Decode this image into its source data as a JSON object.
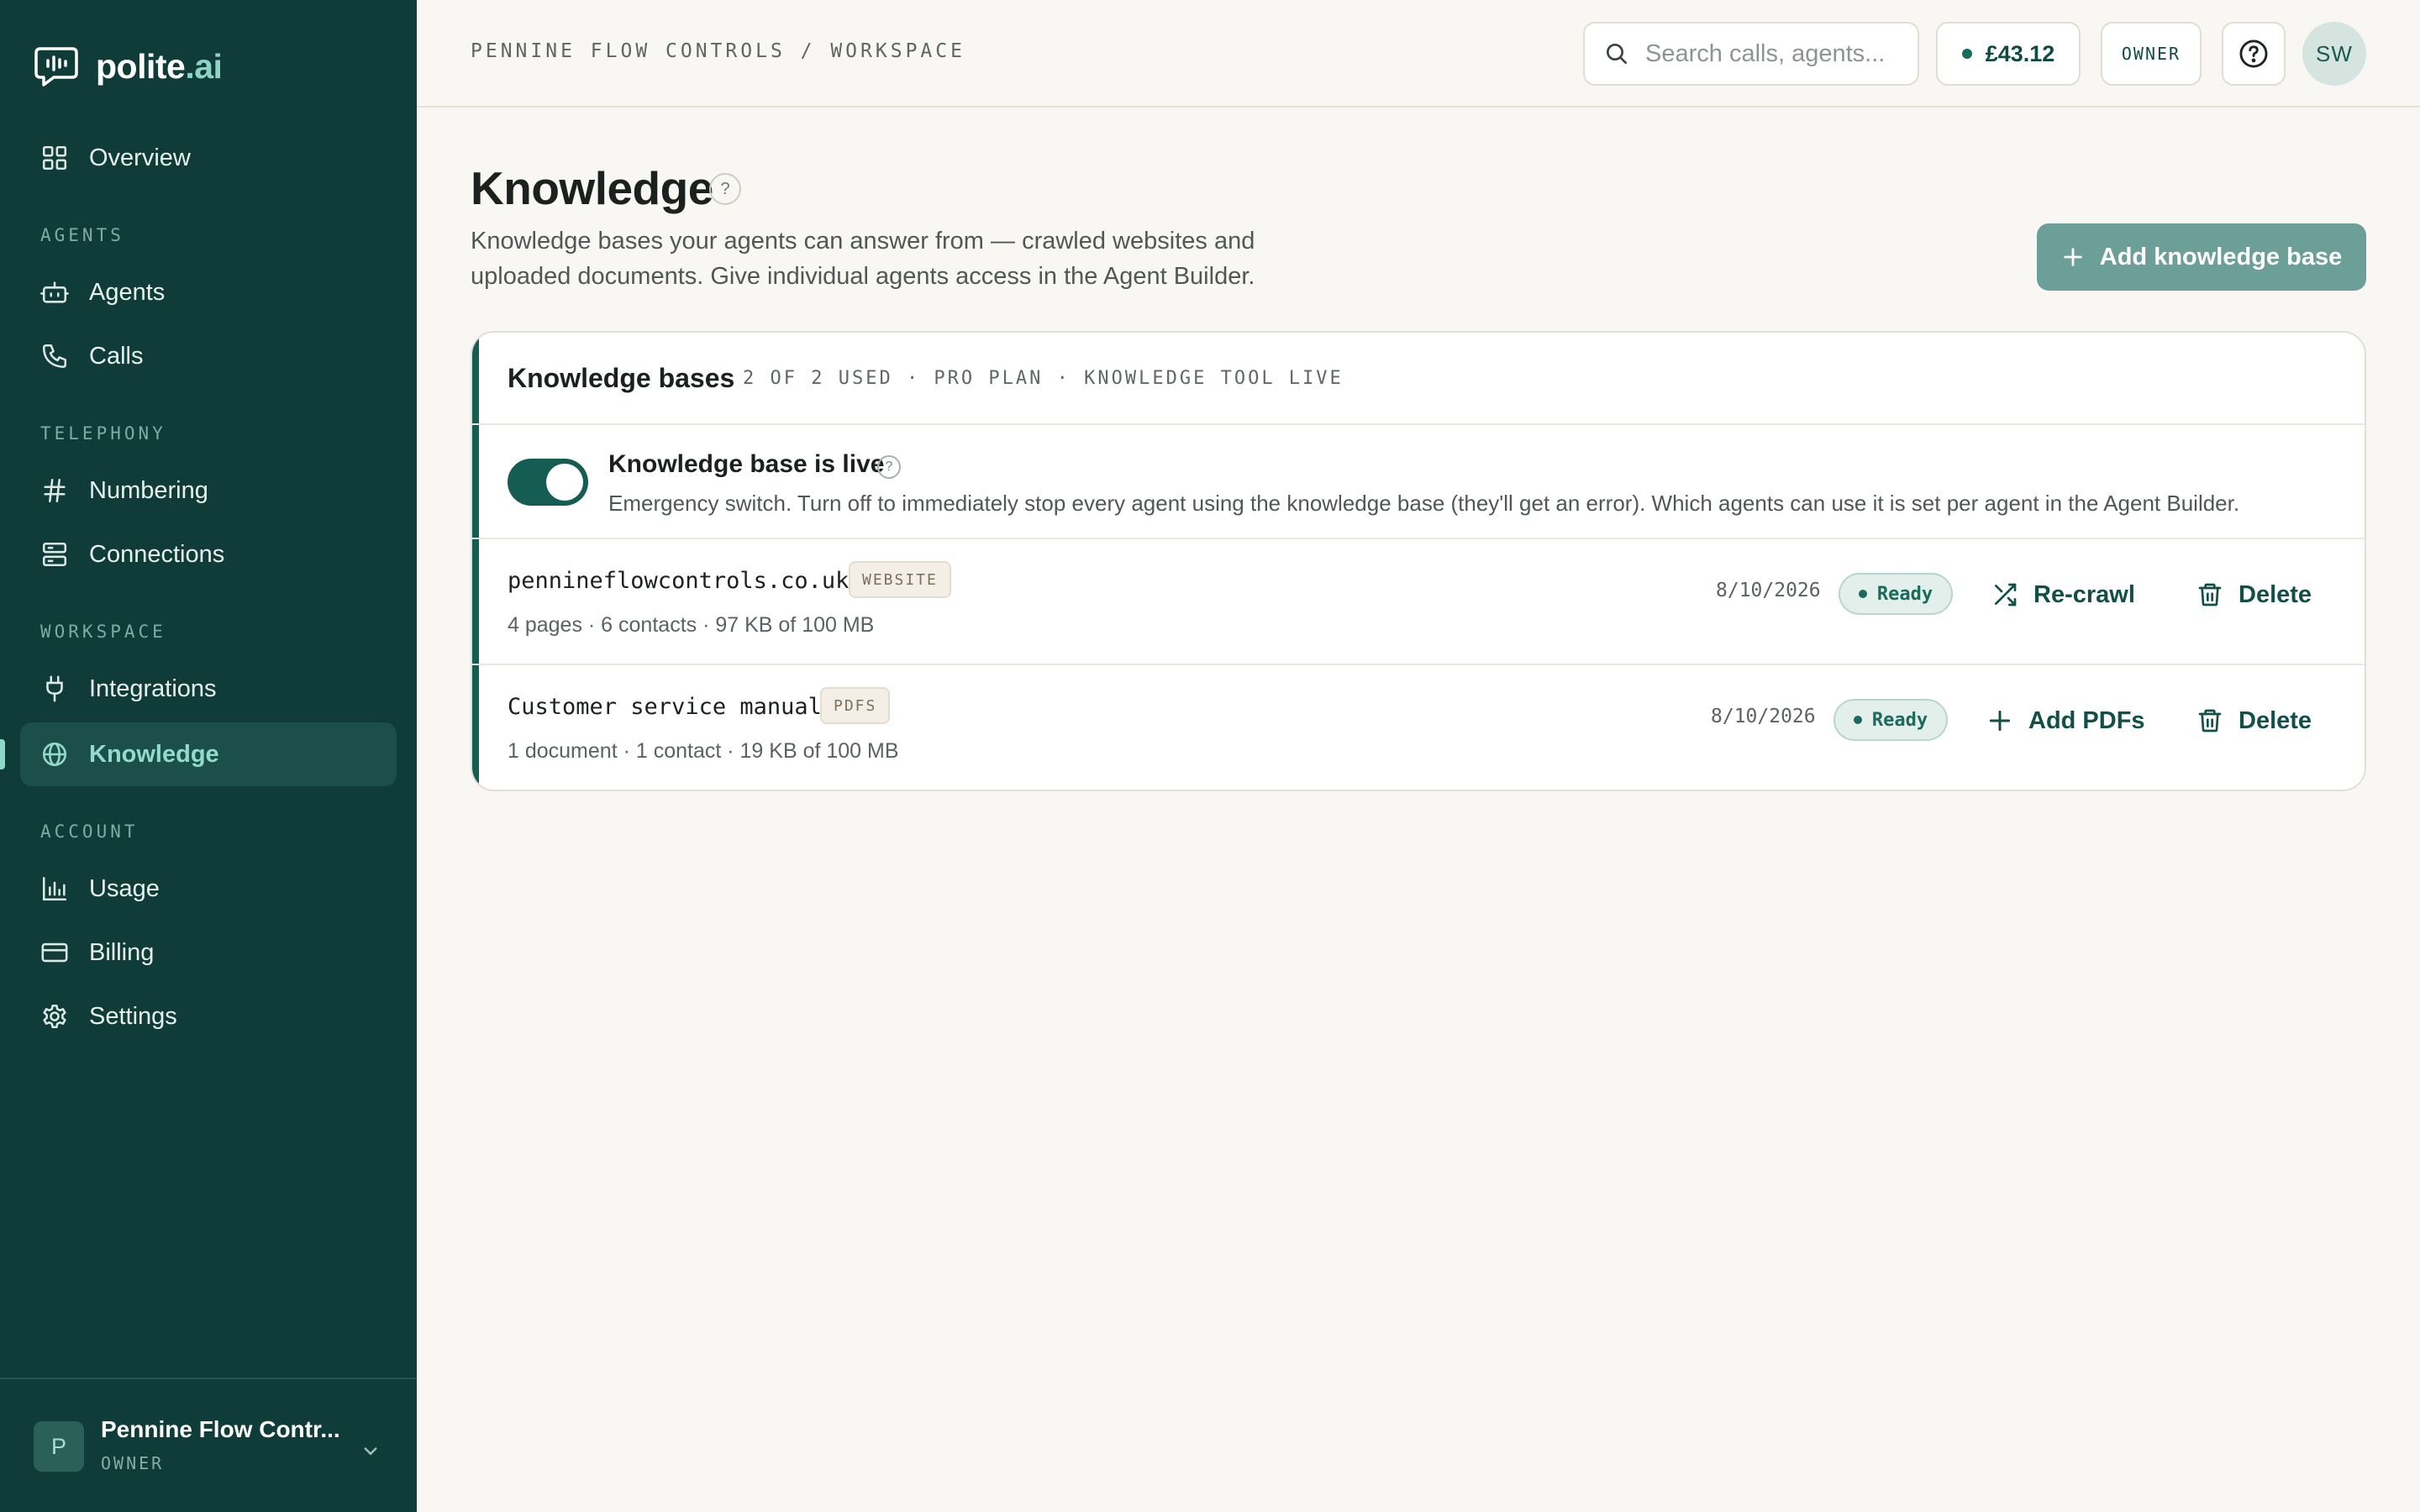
{
  "brand": {
    "name_main": "polite",
    "name_accent": ".ai"
  },
  "nav": {
    "overview": "Overview",
    "sections": {
      "agents": "AGENTS",
      "telephony": "TELEPHONY",
      "workspace": "WORKSPACE",
      "account": "ACCOUNT"
    },
    "agents": "Agents",
    "calls": "Calls",
    "numbering": "Numbering",
    "connections": "Connections",
    "integrations": "Integrations",
    "knowledge": "Knowledge",
    "usage": "Usage",
    "billing": "Billing",
    "settings": "Settings",
    "active_item": "Knowledge"
  },
  "org": {
    "initial": "P",
    "name": "Pennine Flow Contr...",
    "role": "OWNER"
  },
  "topbar": {
    "breadcrumb": "PENNINE FLOW CONTROLS / WORKSPACE",
    "search_placeholder": "Search calls, agents...",
    "balance": "£43.12",
    "role": "OWNER",
    "user_initials": "SW"
  },
  "page": {
    "title": "Knowledge",
    "title_help": "?",
    "subtitle": "Knowledge bases your agents can answer from — crawled websites and uploaded documents. Give individual agents access in the Agent Builder.",
    "add_button": "Add knowledge base"
  },
  "card": {
    "title": "Knowledge bases",
    "meta": "2 OF 2 USED · PRO PLAN · KNOWLEDGE TOOL LIVE",
    "live": {
      "enabled": true,
      "title": "Knowledge base is live",
      "help": "?",
      "description": "Emergency switch. Turn off to immediately stop every agent using the knowledge base (they'll get an error). Which agents can use it is set per agent in the Agent Builder."
    },
    "rows": [
      {
        "name": "pennineflowcontrols.co.uk",
        "tag": "WEBSITE",
        "stats": "4 pages · 6 contacts · 97 KB of 100 MB",
        "date": "8/10/2026",
        "status": "Ready",
        "primary_action": "Re-crawl",
        "delete_action": "Delete"
      },
      {
        "name": "Customer service manual",
        "tag": "PDFS",
        "stats": "1 document · 1 contact · 19 KB of 100 MB",
        "date": "8/10/2026",
        "status": "Ready",
        "primary_action": "Add PDFs",
        "delete_action": "Delete"
      }
    ]
  },
  "colors": {
    "sidebar_bg": "#0f3c38",
    "accent": "#155c52",
    "accent_light": "#8ed3c5",
    "page_bg": "#f9f7f3",
    "button_bg": "#6b9f97"
  }
}
